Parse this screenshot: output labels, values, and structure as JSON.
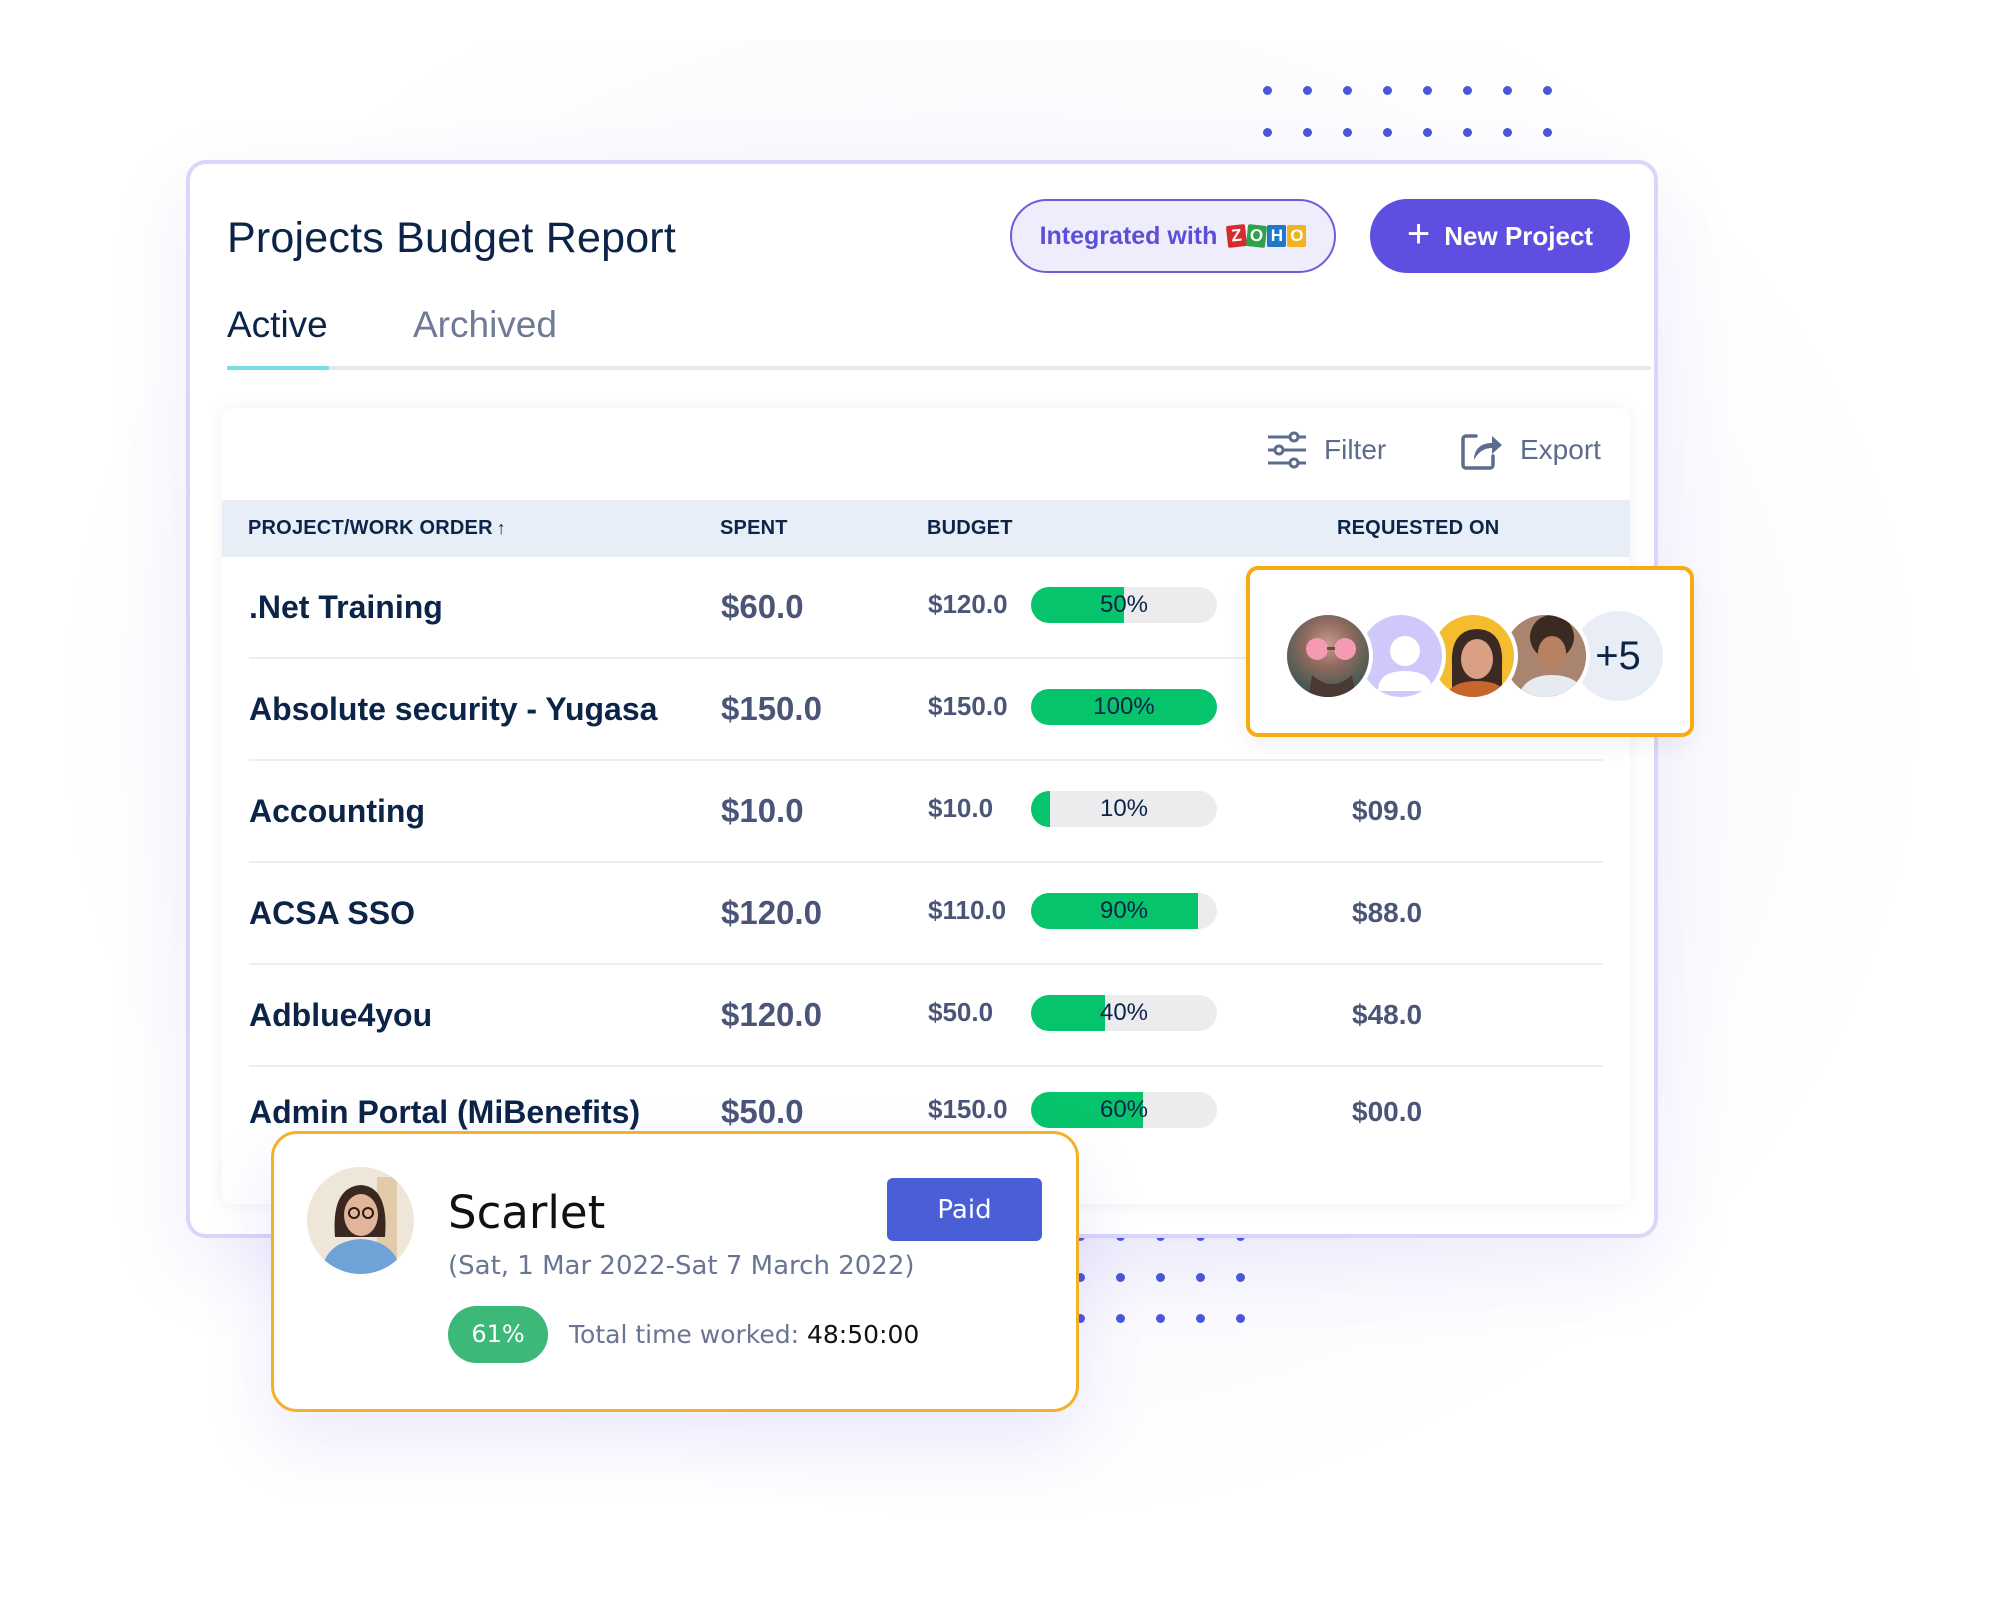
{
  "header": {
    "title": "Projects Budget Report",
    "integration_label": "Integrated with",
    "integration_logo_letters": [
      "Z",
      "O",
      "H",
      "O"
    ],
    "new_project_label": "New Project"
  },
  "tabs": [
    {
      "label": "Active",
      "active": true
    },
    {
      "label": "Archived",
      "active": false
    }
  ],
  "toolbar": {
    "filter_label": "Filter",
    "export_label": "Export"
  },
  "table": {
    "columns": [
      "PROJECT/WORK ORDER",
      "SPENT",
      "BUDGET",
      "REQUESTED ON"
    ],
    "sort_indicator": "↑",
    "rows": [
      {
        "name": ".Net Training",
        "spent": "$60.0",
        "budget": "$120.0",
        "progress": 50,
        "progress_label": "50%",
        "requested": ""
      },
      {
        "name": "Absolute security - Yugasa",
        "spent": "$150.0",
        "budget": "$150.0",
        "progress": 100,
        "progress_label": "100%",
        "requested": ""
      },
      {
        "name": "Accounting",
        "spent": "$10.0",
        "budget": "$10.0",
        "progress": 10,
        "progress_label": "10%",
        "requested": "$09.0"
      },
      {
        "name": "ACSA SSO",
        "spent": "$120.0",
        "budget": "$110.0",
        "progress": 90,
        "progress_label": "90%",
        "requested": "$88.0"
      },
      {
        "name": "Adblue4you",
        "spent": "$120.0",
        "budget": "$50.0",
        "progress": 40,
        "progress_label": "40%",
        "requested": "$48.0"
      },
      {
        "name": "Admin Portal (MiBenefits)",
        "spent": "$50.0",
        "budget": "$150.0",
        "progress": 60,
        "progress_label": "60%",
        "requested": "$00.0"
      }
    ]
  },
  "team_popup": {
    "avatars": [
      {
        "name": "user-1",
        "bg": "#3e5b55"
      },
      {
        "name": "placeholder-user",
        "bg": "#cfc8fb"
      },
      {
        "name": "user-3",
        "bg": "#f4bd2f"
      },
      {
        "name": "user-4",
        "bg": "#c9b8a6"
      }
    ],
    "more_count": "+5"
  },
  "timesheet_popup": {
    "name": "Scarlet",
    "dates": "(Sat, 1 Mar 2022-Sat 7 March 2022)",
    "status": "Paid",
    "percent": "61%",
    "total_time_label": "Total time worked:",
    "total_time_value": "48:50:00"
  },
  "colors": {
    "accent": "#5e4fe0",
    "progress_green": "#05c46b",
    "highlight_border": "#f6ab13",
    "paid_blue": "#4a5ed6",
    "badge_green": "#3cb878"
  }
}
